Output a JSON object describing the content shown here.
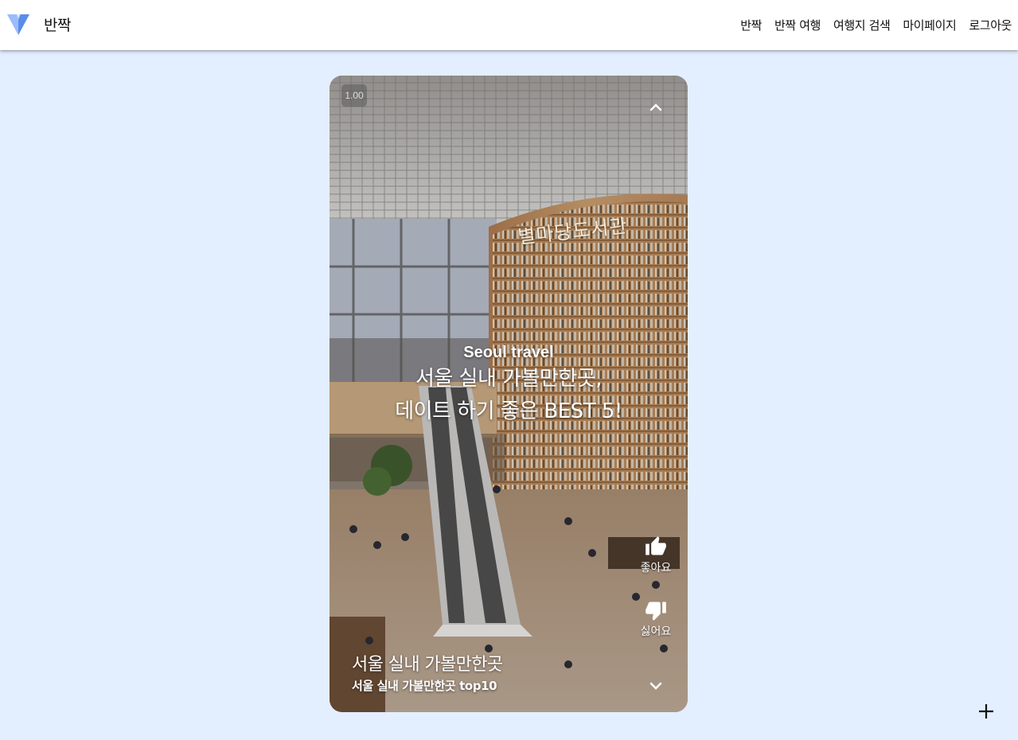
{
  "app": {
    "brand": "반짝",
    "nav": [
      "반짝",
      "반짝 여행",
      "여행지 검색",
      "마이페이지",
      "로그아웃"
    ]
  },
  "video": {
    "volume_label": "1.00",
    "overlay": {
      "line_top": "Seoul travel",
      "line1": "서울 실내 가볼만한곳,",
      "line2": "데이트 하기 좋은 BEST 5!"
    },
    "sign_text": "별마당도서관",
    "like_label": "좋아요",
    "dislike_label": "싫어요",
    "title": "서울 실내 가볼만한곳",
    "subtitle": "서울 실내 가볼만한곳 top10"
  },
  "icons": {
    "logo": "vuetify-logo-icon",
    "up": "chevron-up-icon",
    "down": "chevron-down-icon",
    "like": "thumb-up-icon",
    "dislike": "thumb-down-icon",
    "add": "plus-icon"
  },
  "colors": {
    "page_bg": "#e3efff",
    "appbar_bg": "#ffffff",
    "logo_light": "#8cb4ff",
    "logo_dark": "#5a8de8"
  }
}
